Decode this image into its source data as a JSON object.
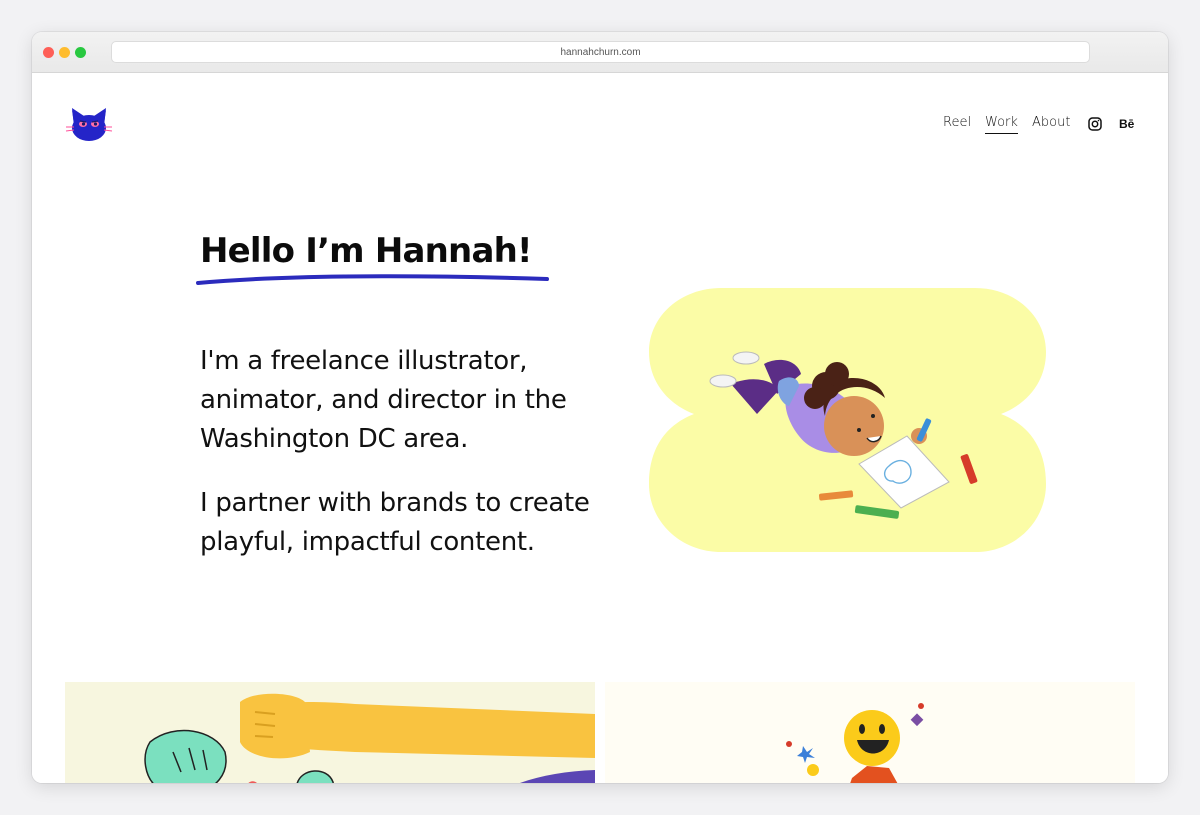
{
  "browser": {
    "url": "hannahchurn.com",
    "traffic_lights": {
      "close": "#fe5f57",
      "minimize": "#febc2e",
      "maximize": "#28c840"
    }
  },
  "header": {
    "logo_icon": "cat-head-icon",
    "nav": {
      "reel": "Reel",
      "work": "Work",
      "about": "About",
      "instagram_icon": "instagram-icon",
      "behance": "Bē"
    }
  },
  "hero": {
    "title": "Hello I’m Hannah!",
    "underline_color": "#2b2bbd",
    "paragraph_1": "I'm a freelance illustrator, animator, and director in the Washington DC area.",
    "paragraph_2": "I partner with brands to create playful, impactful content.",
    "blob_color": "#fbfca6"
  },
  "thumbnails": [
    {
      "name": "hands-illustration",
      "background": "#f7f6df"
    },
    {
      "name": "emoji-characters-illustration",
      "background": "#fffdf4"
    }
  ]
}
